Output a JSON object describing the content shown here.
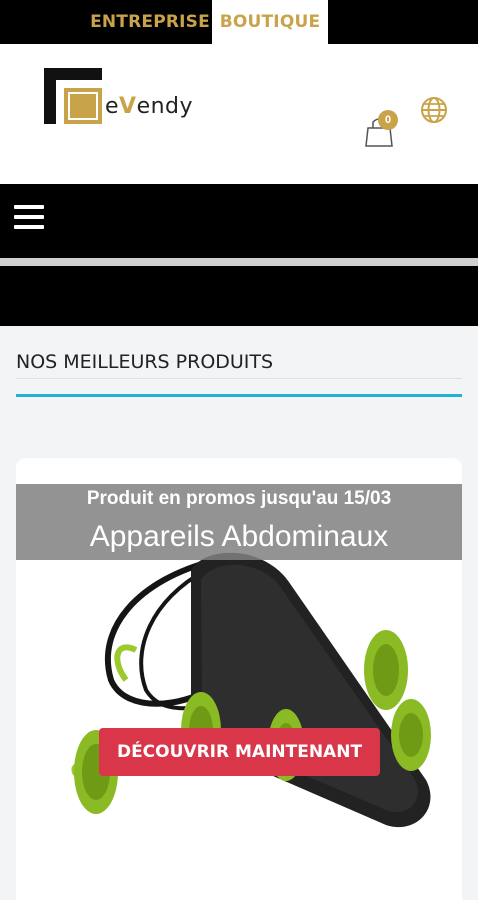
{
  "topbar": {
    "tabs": [
      "ENTREPRISE",
      "BOUTIQUE"
    ],
    "active_tab": "BOUTIQUE"
  },
  "header": {
    "logo_text_prefix": "e",
    "logo_text_accent": "V",
    "logo_text_suffix": "endy",
    "cart_count": "0"
  },
  "icons": {
    "cart": "shopping-bag-icon",
    "globe": "globe-icon",
    "menu": "hamburger-menu-icon"
  },
  "section": {
    "title": "NOS MEILLEURS PRODUITS"
  },
  "product_card": {
    "promo_text": "Produit en promos jusqu'au 15/03",
    "product_name": "Appareils Abdominaux",
    "cta_label": "DÉCOUVRIR MAINTENANT"
  },
  "colors": {
    "accent_gold": "#c9a34a",
    "cta_red": "#d9364a",
    "section_line": "#1eb2d6",
    "bar_black": "#000000"
  }
}
